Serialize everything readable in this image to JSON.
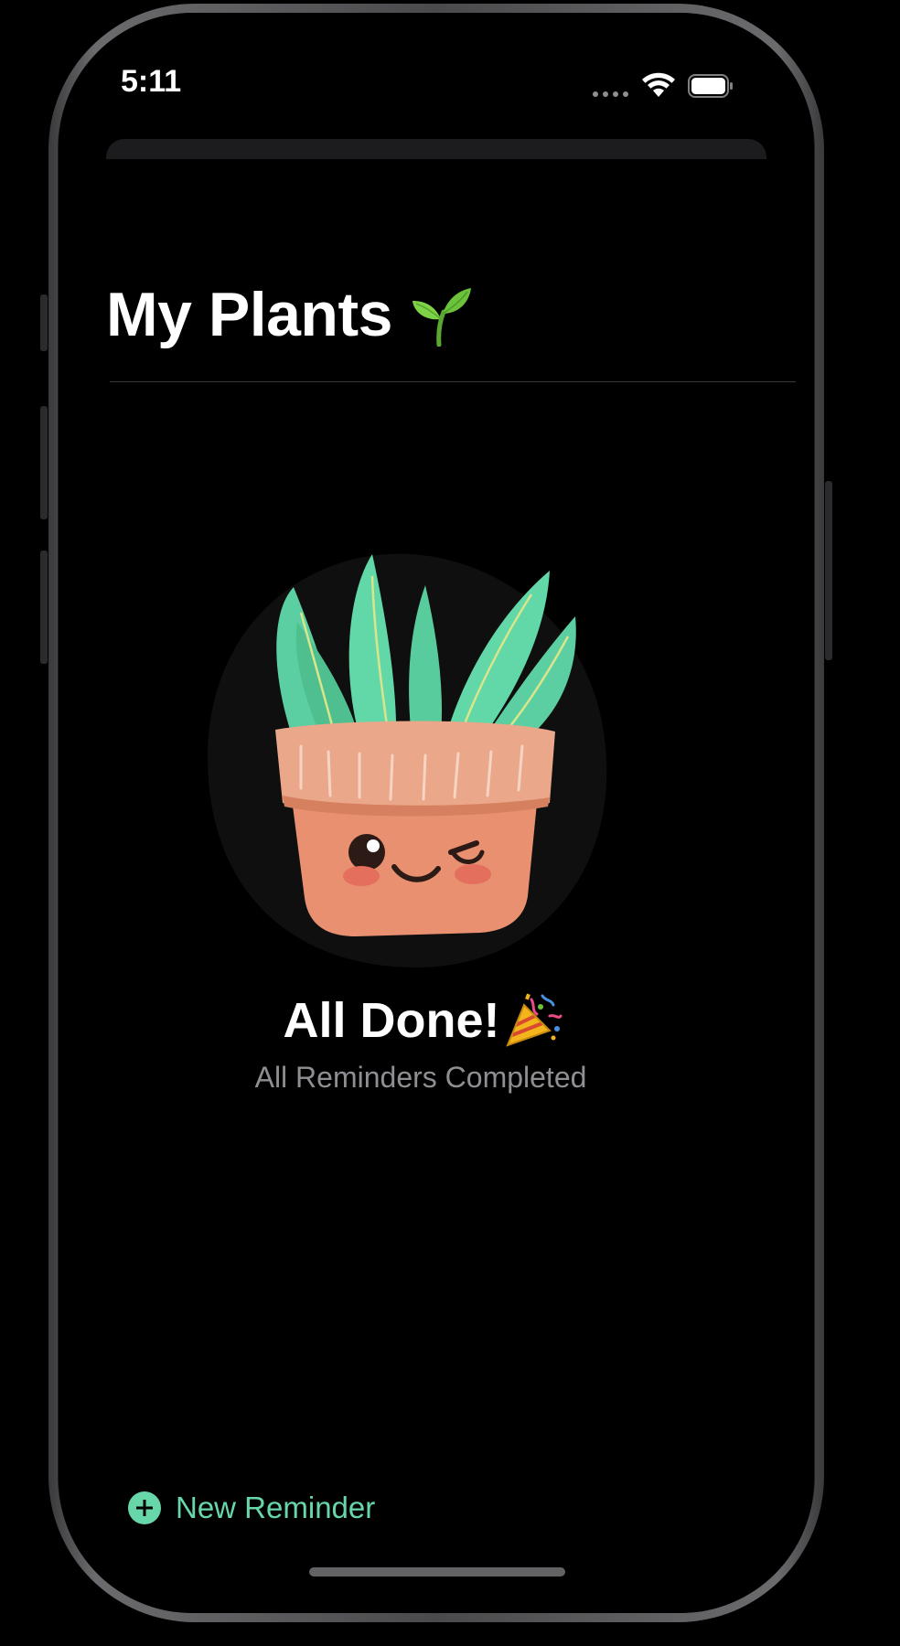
{
  "status_bar": {
    "time": "5:11"
  },
  "header": {
    "title": "My Plants",
    "title_icon": "seedling-icon"
  },
  "empty_state": {
    "title": "All Done!",
    "title_icon": "party-popper-icon",
    "subtitle": "All Reminders Completed",
    "illustration": "winking-potted-succulent"
  },
  "toolbar": {
    "new_reminder_label": "New Reminder",
    "new_reminder_icon": "plus-circle-icon"
  },
  "colors": {
    "accent": "#67d6a8",
    "background": "#000000",
    "secondary_text": "#8e8e93"
  }
}
